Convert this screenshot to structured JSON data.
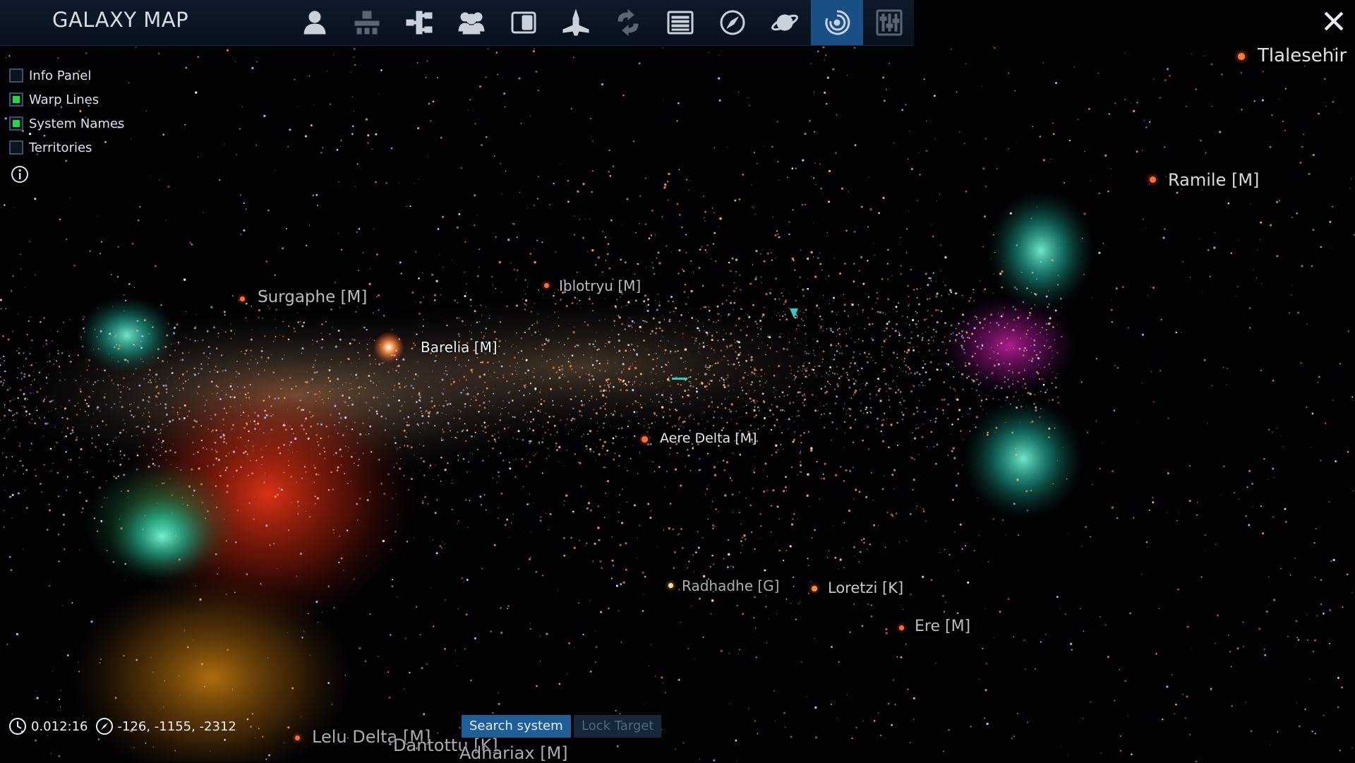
{
  "window": {
    "title": "GALAXY MAP",
    "close_icon": "close-icon"
  },
  "toolbar": {
    "tools": [
      {
        "icon": "player-icon",
        "state": "normal"
      },
      {
        "icon": "stations-icon",
        "state": "dim"
      },
      {
        "icon": "network-icon",
        "state": "normal"
      },
      {
        "icon": "crew-icon",
        "state": "normal"
      },
      {
        "icon": "journal-icon",
        "state": "normal"
      },
      {
        "icon": "ship-icon",
        "state": "normal"
      },
      {
        "icon": "trade-icon",
        "state": "dim"
      },
      {
        "icon": "list-icon",
        "state": "normal"
      },
      {
        "icon": "compass-icon",
        "state": "normal"
      },
      {
        "icon": "planet-icon",
        "state": "normal"
      },
      {
        "icon": "galaxy-icon",
        "state": "active"
      },
      {
        "icon": "settings-sliders-icon",
        "state": "dim"
      }
    ],
    "active_color": "#1a4f85"
  },
  "options": [
    {
      "label": "Info Panel",
      "checked": false
    },
    {
      "label": "Warp Lines",
      "checked": true
    },
    {
      "label": "System Names",
      "checked": true
    },
    {
      "label": "Territories",
      "checked": false
    }
  ],
  "info_icon": "info-icon",
  "systems": [
    {
      "name": "Tlalesehir",
      "size": 26,
      "color": "#ff7a3a"
    },
    {
      "name": "Ramile [M]",
      "size": 24,
      "color": "#ff6a3a"
    },
    {
      "name": "Surgaphe [M]",
      "size": 23,
      "color": "#ff6a3a"
    },
    {
      "name": "Iblotryu [M]",
      "size": 20,
      "color": "#ff6a3a"
    },
    {
      "name": "Barelia [M]",
      "size": 20,
      "color": "#ff7a2a"
    },
    {
      "name": "Aere Delta [M]",
      "size": 19,
      "color": "#ff6a3a"
    },
    {
      "name": "Radhadhe [G]",
      "size": 20,
      "color": "#ffe09a"
    },
    {
      "name": "Loretzi [K]",
      "size": 21,
      "color": "#ff8a3a"
    },
    {
      "name": "Ere [M]",
      "size": 22,
      "color": "#ff6a3a"
    },
    {
      "name": "Lelu Delta [M]",
      "size": 24,
      "color": "#ff6a3a"
    },
    {
      "name": "Dantottu [K]",
      "size": 24,
      "color": "#ff8a3a"
    },
    {
      "name": "Adhariax [M]",
      "size": 24,
      "color": "#ff6a3a"
    }
  ],
  "status": {
    "clock_icon": "clock-icon",
    "time": "0.012:16",
    "coords_icon": "compass-coords-icon",
    "coordinates": "-126, -1155, -2312"
  },
  "buttons": {
    "search": "Search system",
    "lock": "Lock Target"
  }
}
